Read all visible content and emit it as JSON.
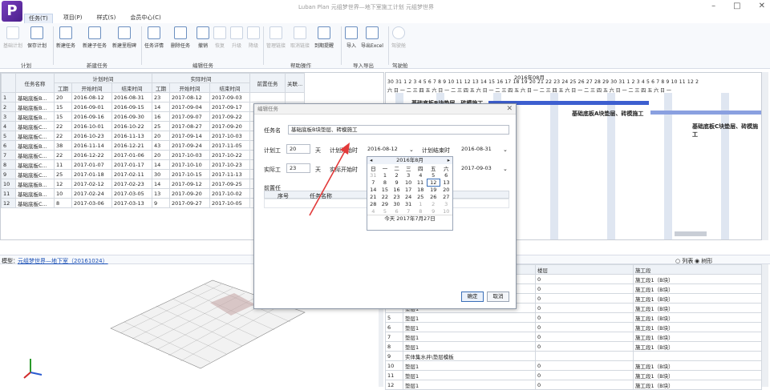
{
  "app": {
    "title": "Luban Plan 元组梦世界—地下室施工计划 元组梦世界",
    "logo": "P"
  },
  "menu": [
    "任务(T)",
    "项目(P)",
    "样式(S)",
    "会员中心(C)"
  ],
  "ribbon": {
    "buttons": [
      "基础计划",
      "保存计划",
      "新建任务",
      "新建子任务",
      "新建里程碑",
      "任务详情",
      "删除任务",
      "撤销",
      "恢复",
      "升级",
      "降级",
      "管理链接",
      "取消链接",
      "到期提醒",
      "导入",
      "导出Excel",
      "驾驶舱"
    ],
    "groups": [
      "计划",
      "新建任务",
      "编辑任务",
      "帮助操作",
      "导入导出",
      "驾驶舱"
    ]
  },
  "grid": {
    "headers": {
      "name": "任务名称",
      "plan": "计划时间",
      "actual": "实际时间",
      "duration": "工期",
      "start": "开始时间",
      "end": "结束时间",
      "pred": "前置任务",
      "rel": "关联..."
    },
    "rows": [
      [
        "1",
        "基础底板B...",
        "20",
        "2016-08-12",
        "2016-08-31",
        "23",
        "2017-08-12",
        "2017-09-03"
      ],
      [
        "2",
        "基础底板B...",
        "15",
        "2016-09-01",
        "2016-09-15",
        "14",
        "2017-09-04",
        "2017-09-17"
      ],
      [
        "3",
        "基础底板B...",
        "15",
        "2016-09-16",
        "2016-09-30",
        "16",
        "2017-09-07",
        "2017-09-22"
      ],
      [
        "4",
        "基础底板C...",
        "22",
        "2016-10-01",
        "2016-10-22",
        "25",
        "2017-08-27",
        "2017-09-20"
      ],
      [
        "5",
        "基础底板C...",
        "22",
        "2016-10-23",
        "2016-11-13",
        "20",
        "2017-09-14",
        "2017-10-03"
      ],
      [
        "6",
        "基础底板B...",
        "38",
        "2016-11-14",
        "2016-12-21",
        "43",
        "2017-09-24",
        "2017-11-05"
      ],
      [
        "7",
        "基础底板C...",
        "22",
        "2016-12-22",
        "2017-01-06",
        "20",
        "2017-10-03",
        "2017-10-22"
      ],
      [
        "8",
        "基础底板C...",
        "11",
        "2017-01-07",
        "2017-01-17",
        "14",
        "2017-10-10",
        "2017-10-23"
      ],
      [
        "9",
        "基础底板C...",
        "25",
        "2017-01-18",
        "2017-02-11",
        "30",
        "2017-10-15",
        "2017-11-13"
      ],
      [
        "10",
        "基础底板B...",
        "12",
        "2017-02-12",
        "2017-02-23",
        "14",
        "2017-09-12",
        "2017-09-25"
      ],
      [
        "11",
        "基础底板B...",
        "10",
        "2017-02-24",
        "2017-03-05",
        "13",
        "2017-09-20",
        "2017-10-02"
      ],
      [
        "12",
        "基础底板C...",
        "8",
        "2017-03-06",
        "2017-03-13",
        "9",
        "2017-09-27",
        "2017-10-05"
      ]
    ]
  },
  "gantt": {
    "month": "2016年08月",
    "days": "30 31  1  2  3  4  5  6  7  8  9 10 11 12 13 14 15 16 17 18 19 20 21 22 23 24 25 26 27 28 29 30 31  1  2  3  4  5  6  7  8  9 10 11 12  2",
    "weekdays": "六 日 一 二 三 四 五 六 日 一 二 三 四 五 六 日 一 二 三 四 五 六 日 一 二 三 四 五 六 日 一 二 三 四 五 六 日 一 二 三 四 五 六 日 一",
    "labels": [
      "基础底板B块垫层、砖模施工",
      "基础底板A块垫层、砖模施工",
      "基础底板C块垫层、砖模施工"
    ]
  },
  "midbar": {
    "model_label": "模型：",
    "model_link": "元组梦世界—地下室（20161024）",
    "list_option": "列表",
    "tree_option": "树形"
  },
  "lower": {
    "headers": [
      "楼层",
      "施工段"
    ],
    "rows": [
      [
        "",
        "垫层1",
        "0",
        "施工段1（B块）"
      ],
      [
        "",
        "垫层1",
        "0",
        "施工段1（B块）"
      ],
      [
        "",
        "垫层1",
        "0",
        "施工段1（B块）"
      ],
      [
        "",
        "垫层1",
        "0",
        "施工段1（B块）"
      ],
      [
        "5",
        "垫层1",
        "0",
        "施工段1（B块）"
      ],
      [
        "6",
        "垫层1",
        "0",
        "施工段1（B块）"
      ],
      [
        "7",
        "垫层1",
        "0",
        "施工段1（B块）"
      ],
      [
        "8",
        "垫层1",
        "0",
        "施工段1（B块）"
      ],
      [
        "9",
        "实体集水井\\垫层模板",
        "",
        ""
      ],
      [
        "10",
        "垫层1",
        "0",
        "施工段1（B块）"
      ],
      [
        "11",
        "垫层1",
        "0",
        "施工段1（B块）"
      ],
      [
        "12",
        "垫层1",
        "0",
        "施工段1（B块）"
      ]
    ]
  },
  "dialog": {
    "title": "编辑任务",
    "task_name_label": "任务名",
    "task_name": "基础底板B块垫层、砖模施工",
    "plan_duration_label": "计划工",
    "plan_duration": "20",
    "day_unit": "天",
    "plan_start_label": "计划开始时",
    "plan_start": "2016-08-12",
    "plan_end_label": "计划结束时",
    "plan_end": "2016-08-31",
    "actual_duration_label": "实际工",
    "actual_duration": "23",
    "actual_start_label": "实际开始时",
    "actual_end": "2017-09-03",
    "pred_label": "前置任",
    "pred_cols": [
      "序号",
      "任务名称"
    ],
    "ok": "确定",
    "cancel": "取消"
  },
  "calendar": {
    "header": "2016年8月",
    "weekdays": [
      "日",
      "一",
      "二",
      "三",
      "四",
      "五",
      "六"
    ],
    "weeks": [
      [
        "31",
        "1",
        "2",
        "3",
        "4",
        "5",
        "6"
      ],
      [
        "7",
        "8",
        "9",
        "10",
        "11",
        "12",
        "13"
      ],
      [
        "14",
        "15",
        "16",
        "17",
        "18",
        "19",
        "20"
      ],
      [
        "21",
        "22",
        "23",
        "24",
        "25",
        "26",
        "27"
      ],
      [
        "28",
        "29",
        "30",
        "31",
        "1",
        "2",
        "3"
      ],
      [
        "4",
        "5",
        "6",
        "7",
        "8",
        "9",
        "10"
      ]
    ],
    "today": "今天 2017年7月27日"
  },
  "colors": {
    "accent": "#3d5fd0",
    "brand": "#5a2ea6",
    "arrow": "#e23a3a"
  }
}
